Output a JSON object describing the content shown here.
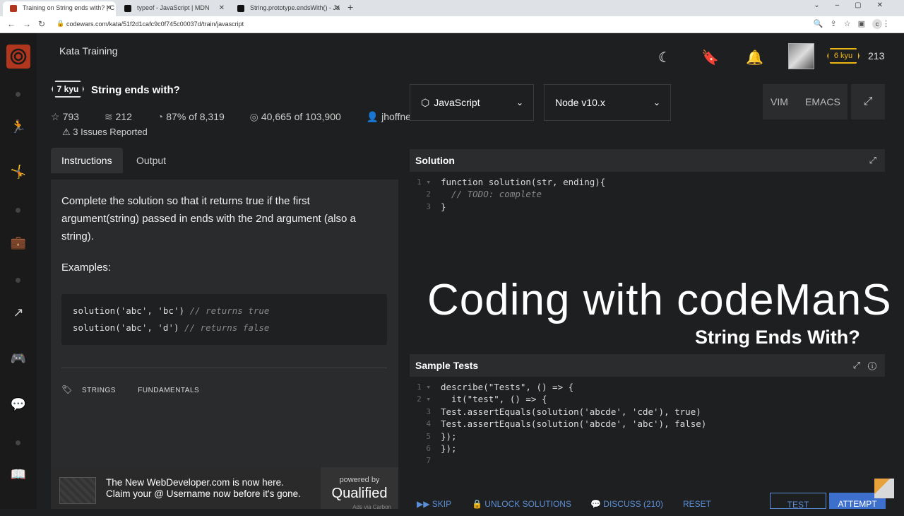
{
  "browser": {
    "tabs": [
      {
        "title": "Training on String ends with? | C",
        "active": true
      },
      {
        "title": "typeof - JavaScript | MDN",
        "active": false
      },
      {
        "title": "String.prototype.endsWith() - Ja",
        "active": false
      }
    ],
    "url": "codewars.com/kata/51f2d1cafc9c0f745c00037d/train/javascript",
    "profile_initial": "c"
  },
  "app": {
    "section_title": "Kata Training",
    "user_rank": "6 kyu",
    "honor": "213"
  },
  "kata": {
    "rank": "7 kyu",
    "title": "String ends with?",
    "stars": "793",
    "collections": "212",
    "satisfaction": "87% of 8,319",
    "completions": "40,665 of 103,900",
    "author": "jhoffner",
    "issues": "3 Issues Reported",
    "tabs": [
      "Instructions",
      "Output"
    ],
    "description": "Complete the solution so that it returns true if the first argument(string) passed in ends with the 2nd argument (also a string).",
    "examples_label": "Examples:",
    "examples": [
      {
        "code": "solution('abc', 'bc')",
        "comment": "// returns true"
      },
      {
        "code": "solution('abc', 'd')",
        "comment": "// returns false"
      }
    ],
    "tags": [
      "STRINGS",
      "FUNDAMENTALS"
    ]
  },
  "ad": {
    "line1": "The New WebDeveloper.com is now here.",
    "line2": "Claim your @ Username now before it's gone.",
    "powered_by": "powered by",
    "powered_brand": "Qualified",
    "ads_via": "Ads via Carbon"
  },
  "editor": {
    "language": "JavaScript",
    "runtime": "Node v10.x",
    "modes": [
      "VIM",
      "EMACS"
    ],
    "solution_title": "Solution",
    "solution_lines": [
      "function solution(str, ending){",
      "  // TODO: complete",
      "}"
    ],
    "tests_title": "Sample Tests",
    "test_lines": [
      "describe(\"Tests\", () => {",
      "  it(\"test\", () => {",
      "Test.assertEquals(solution('abcde', 'cde'), true)",
      "Test.assertEquals(solution('abcde', 'abc'), false)",
      "});",
      "});",
      ""
    ]
  },
  "overlay": {
    "title": "Coding with codeManS",
    "subtitle": "String Ends With?"
  },
  "actions": {
    "skip": "SKIP",
    "unlock": "UNLOCK SOLUTIONS",
    "discuss": "DISCUSS (210)",
    "reset": "RESET",
    "test": "TEST",
    "attempt": "ATTEMPT"
  },
  "colors": {
    "accent": "#b1361e",
    "kyu_yellow": "#ecb613",
    "action_blue": "#3d6fcc"
  }
}
